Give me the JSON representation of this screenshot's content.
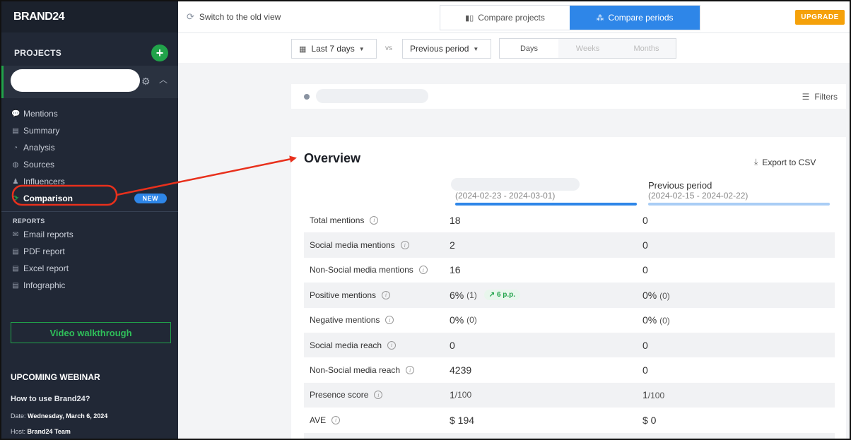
{
  "sidebar": {
    "logo": "BRAND24",
    "projects_title": "PROJECTS",
    "add_symbol": "+",
    "nav": [
      {
        "label": "Mentions",
        "icon": "💬"
      },
      {
        "label": "Summary",
        "icon": "▤"
      },
      {
        "label": "Analysis",
        "icon": "◔"
      },
      {
        "label": "Sources",
        "icon": "◍"
      },
      {
        "label": "Influencers",
        "icon": "♟"
      },
      {
        "label": "Comparison",
        "icon": "⟳"
      }
    ],
    "new_badge": "NEW",
    "reports_title": "REPORTS",
    "reports": [
      {
        "label": "Email reports",
        "icon": "✉"
      },
      {
        "label": "PDF report",
        "icon": "▤"
      },
      {
        "label": "Excel report",
        "icon": "▤"
      },
      {
        "label": "Infographic",
        "icon": "▤"
      }
    ],
    "video_button": "Video walkthrough",
    "webinar": {
      "section_title": "UPCOMING WEBINAR",
      "name": "How to use Brand24?",
      "date_label": "Date:",
      "date_value": "Wednesday, March 6, 2024",
      "host_label": "Host:",
      "host_value": "Brand24 Team"
    }
  },
  "topbar": {
    "old_view": "Switch to the old view",
    "compare_projects": "Compare projects",
    "compare_periods": "Compare periods",
    "upgrade": "UPGRADE"
  },
  "filters": {
    "range": "Last 7 days",
    "vs": "vs",
    "compare_to": "Previous period",
    "granularity": [
      "Days",
      "Weeks",
      "Months"
    ],
    "filters_label": "Filters"
  },
  "overview": {
    "title": "Overview",
    "export": "Export to CSV",
    "current_dates": "(2024-02-23 - 2024-03-01)",
    "previous_name": "Previous period",
    "previous_dates": "(2024-02-15 - 2024-02-22)",
    "rows": [
      {
        "label": "Total mentions",
        "v1": "18",
        "v2": "0"
      },
      {
        "label": "Social media mentions",
        "v1": "2",
        "v2": "0"
      },
      {
        "label": "Non-Social media mentions",
        "v1": "16",
        "v2": "0"
      },
      {
        "label": "Positive mentions",
        "v1": "6%",
        "v1_small": "(1)",
        "trend": "↗ 6 p.p.",
        "v2": "0%",
        "v2_small": "(0)"
      },
      {
        "label": "Negative mentions",
        "v1": "0%",
        "v1_small": "(0)",
        "v2": "0%",
        "v2_small": "(0)"
      },
      {
        "label": "Social media reach",
        "v1": "0",
        "v2": "0"
      },
      {
        "label": "Non-Social media reach",
        "v1": "4239",
        "v2": "0"
      },
      {
        "label": "Presence score",
        "v1": "1",
        "v1_small": "/100",
        "v2": "1",
        "v2_small": "/100"
      },
      {
        "label": "AVE",
        "v1": "$ 194",
        "v2": "$ 0"
      }
    ]
  },
  "colors": {
    "accent": "#2e86e8",
    "brand_green": "#21a34a",
    "upgrade": "#f5a10a",
    "annotation_red": "#e8301c"
  }
}
